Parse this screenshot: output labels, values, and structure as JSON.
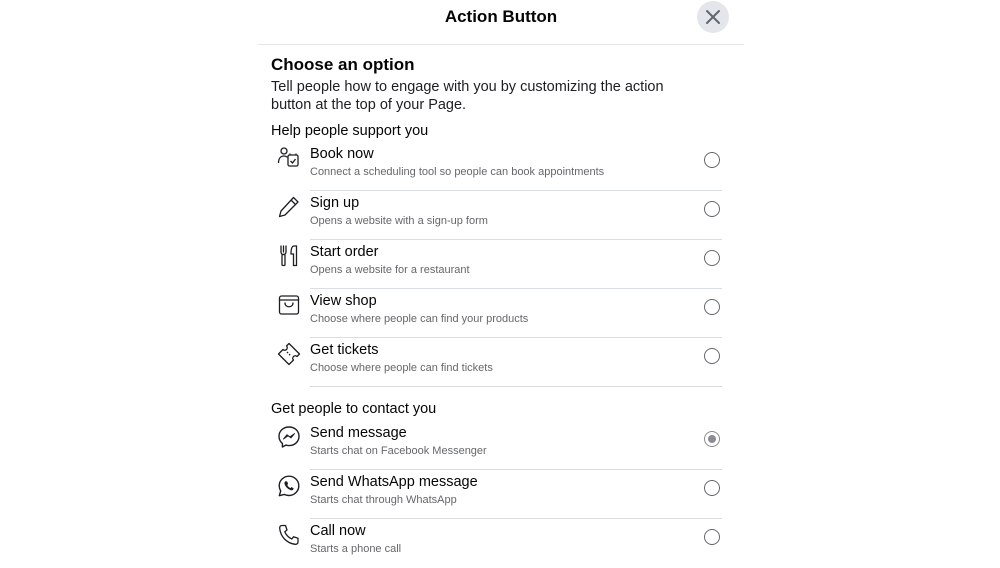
{
  "dialog": {
    "title": "Action Button",
    "close_icon": "close-icon"
  },
  "intro": {
    "title": "Choose an option",
    "description": "Tell people how to engage with you by customizing the action button at the top of your Page."
  },
  "sections": [
    {
      "title": "Help people support you",
      "options": [
        {
          "label": "Book now",
          "description": "Connect a scheduling tool so people can book appointments",
          "icon": "calendar-person-icon",
          "selected": false
        },
        {
          "label": "Sign up",
          "description": "Opens a website with a sign-up form",
          "icon": "pencil-icon",
          "selected": false
        },
        {
          "label": "Start order",
          "description": "Opens a website for a restaurant",
          "icon": "fork-knife-icon",
          "selected": false
        },
        {
          "label": "View shop",
          "description": "Choose where people can find your products",
          "icon": "shopping-bag-icon",
          "selected": false
        },
        {
          "label": "Get tickets",
          "description": "Choose where people can find tickets",
          "icon": "ticket-icon",
          "selected": false
        }
      ]
    },
    {
      "title": "Get people to contact you",
      "options": [
        {
          "label": "Send message",
          "description": "Starts chat on Facebook Messenger",
          "icon": "messenger-icon",
          "selected": true
        },
        {
          "label": "Send WhatsApp message",
          "description": "Starts chat through WhatsApp",
          "icon": "whatsapp-icon",
          "selected": false
        },
        {
          "label": "Call now",
          "description": "Starts a phone call",
          "icon": "phone-icon",
          "selected": false
        }
      ]
    }
  ],
  "colors": {
    "text_primary": "#050505",
    "text_secondary": "#65676b",
    "divider": "#dadde1",
    "close_bg": "#e4e6eb",
    "radio_selected": "#8a8d91"
  }
}
